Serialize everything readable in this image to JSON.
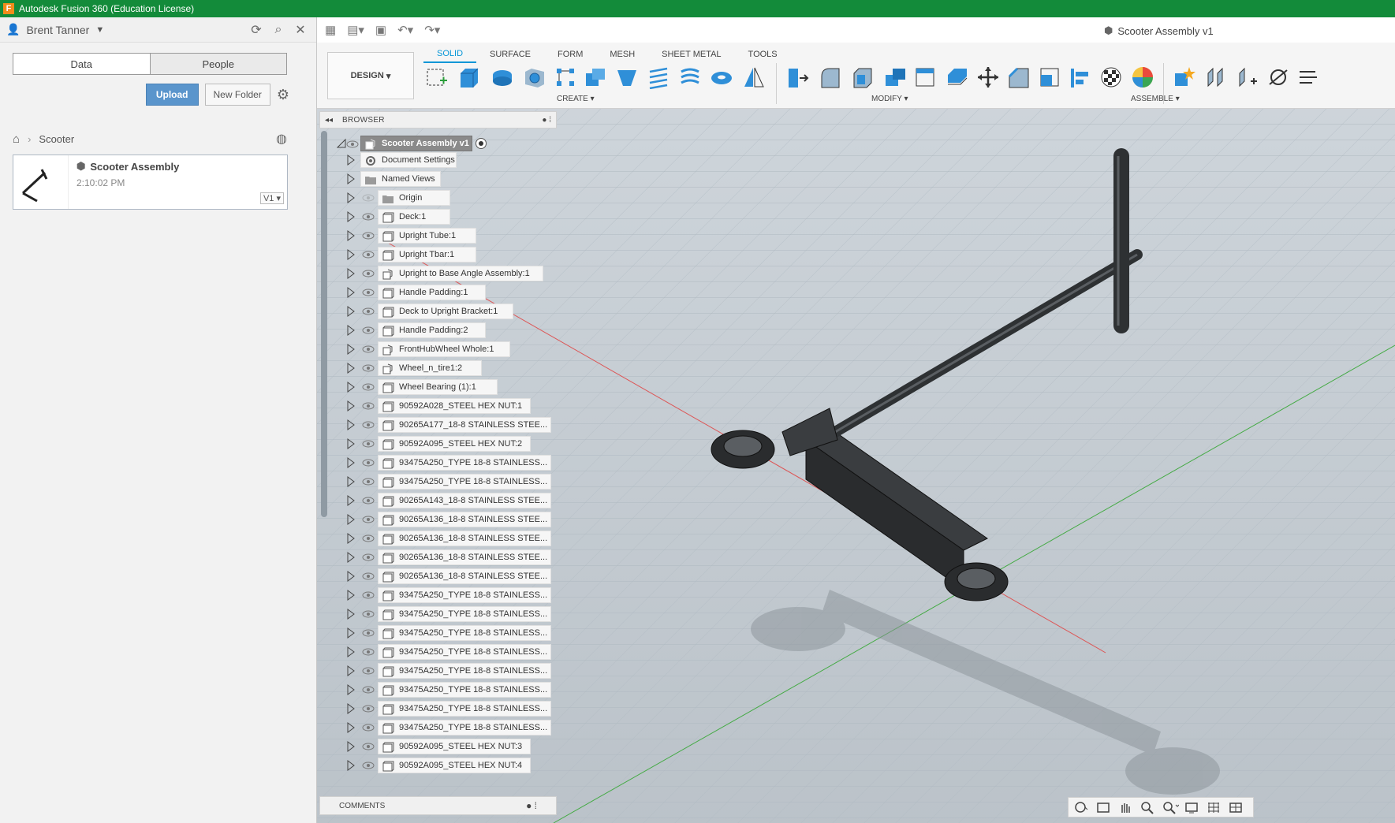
{
  "app": {
    "title": "Autodesk Fusion 360 (Education License)"
  },
  "datapanel": {
    "user": "Brent Tanner",
    "tabs": [
      "Data",
      "People"
    ],
    "upload_label": "Upload",
    "new_folder_label": "New Folder",
    "breadcrumb": "Scooter",
    "file": {
      "name": "Scooter Assembly",
      "time": "2:10:02 PM",
      "version": "V1"
    }
  },
  "doc_title": "Scooter Assembly v1",
  "ribbon": {
    "workspace": "DESIGN",
    "tabs": [
      "SOLID",
      "SURFACE",
      "FORM",
      "MESH",
      "SHEET METAL",
      "TOOLS"
    ],
    "groups": {
      "create": "CREATE",
      "modify": "MODIFY",
      "assemble": "ASSEMBLE"
    }
  },
  "browser": {
    "title": "BROWSER",
    "root": "Scooter Assembly v1",
    "items": [
      {
        "label": "Document Settings",
        "icon": "gear"
      },
      {
        "label": "Named Views",
        "icon": "folder"
      },
      {
        "label": "Origin",
        "icon": "folder"
      },
      {
        "label": "Deck:1",
        "icon": "component"
      },
      {
        "label": "Upright Tube:1",
        "icon": "component"
      },
      {
        "label": "Upright Tbar:1",
        "icon": "component"
      },
      {
        "label": "Upright to Base Angle Assembly:1",
        "icon": "assembly"
      },
      {
        "label": "Handle Padding:1",
        "icon": "component"
      },
      {
        "label": "Deck to Upright Bracket:1",
        "icon": "component"
      },
      {
        "label": "Handle Padding:2",
        "icon": "component"
      },
      {
        "label": "FrontHubWheel Whole:1",
        "icon": "assembly"
      },
      {
        "label": "Wheel_n_tire1:2",
        "icon": "assembly"
      },
      {
        "label": "Wheel Bearing (1):1",
        "icon": "component"
      },
      {
        "label": "90592A028_STEEL HEX NUT:1",
        "icon": "component"
      },
      {
        "label": "90265A177_18-8 STAINLESS STEE...",
        "icon": "component"
      },
      {
        "label": "90592A095_STEEL HEX NUT:2",
        "icon": "component"
      },
      {
        "label": "93475A250_TYPE 18-8 STAINLESS...",
        "icon": "component"
      },
      {
        "label": "93475A250_TYPE 18-8 STAINLESS...",
        "icon": "component"
      },
      {
        "label": "90265A143_18-8 STAINLESS STEE...",
        "icon": "component"
      },
      {
        "label": "90265A136_18-8 STAINLESS STEE...",
        "icon": "component"
      },
      {
        "label": "90265A136_18-8 STAINLESS STEE...",
        "icon": "component"
      },
      {
        "label": "90265A136_18-8 STAINLESS STEE...",
        "icon": "component"
      },
      {
        "label": "90265A136_18-8 STAINLESS STEE...",
        "icon": "component"
      },
      {
        "label": "93475A250_TYPE 18-8 STAINLESS...",
        "icon": "component"
      },
      {
        "label": "93475A250_TYPE 18-8 STAINLESS...",
        "icon": "component"
      },
      {
        "label": "93475A250_TYPE 18-8 STAINLESS...",
        "icon": "component"
      },
      {
        "label": "93475A250_TYPE 18-8 STAINLESS...",
        "icon": "component"
      },
      {
        "label": "93475A250_TYPE 18-8 STAINLESS...",
        "icon": "component"
      },
      {
        "label": "93475A250_TYPE 18-8 STAINLESS...",
        "icon": "component"
      },
      {
        "label": "93475A250_TYPE 18-8 STAINLESS...",
        "icon": "component"
      },
      {
        "label": "93475A250_TYPE 18-8 STAINLESS...",
        "icon": "component"
      },
      {
        "label": "90592A095_STEEL HEX NUT:3",
        "icon": "component"
      },
      {
        "label": "90592A095_STEEL HEX NUT:4",
        "icon": "component"
      }
    ]
  },
  "comments_label": "COMMENTS",
  "colors": {
    "titlebar": "#138b3a",
    "accent": "#0696d7",
    "upload": "#5a95cc"
  }
}
